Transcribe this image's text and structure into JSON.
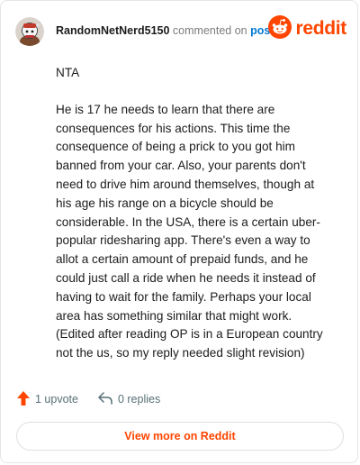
{
  "comment": {
    "username": "RandomNetNerd5150",
    "commented_on": "commented on",
    "post_link": "post",
    "brand": "reddit",
    "paragraphs": [
      "NTA",
      "He is 17 he needs to learn that there are consequences for his actions. This time the consequence of being a prick to you got him banned from your car. Also, your parents don't need to drive him around themselves, though at his age his range on a bicycle should be considerable. In the USA, there is a certain uber-popular ridesharing app. There's even a way to allot a certain amount of prepaid funds, and he could just call a ride when he needs it instead of having to wait for the family. Perhaps your local area has something similar that might work. (Edited after reading OP is in a European country not the us, so my reply needed slight revision)"
    ],
    "upvotes_label": "1 upvote",
    "replies_label": "0 replies",
    "view_more_label": "View more on Reddit"
  },
  "colors": {
    "brand": "#ff4500",
    "link": "#0079d3",
    "muted": "#7c7c7c"
  },
  "icons": {
    "upvote": "upvote-arrow-icon",
    "reply": "reply-arrow-icon",
    "brand": "reddit-snoo-icon"
  }
}
